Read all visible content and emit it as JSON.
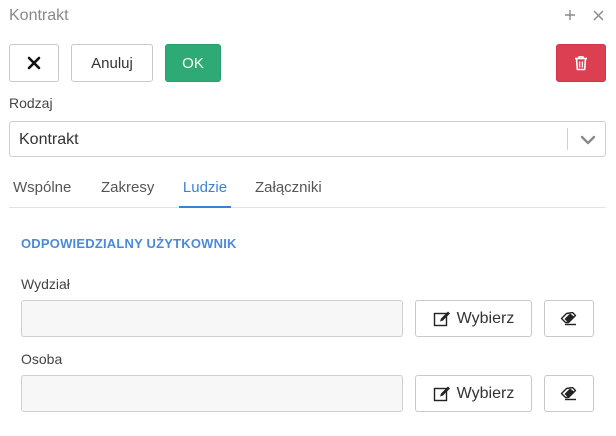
{
  "window": {
    "title": "Kontrakt",
    "add_icon": "plus-icon",
    "close_icon": "close-icon"
  },
  "toolbar": {
    "close_icon": "x-icon",
    "cancel_label": "Anuluj",
    "ok_label": "OK",
    "delete_icon": "trash-icon"
  },
  "form": {
    "type_label": "Rodzaj",
    "type_value": "Kontrakt"
  },
  "tabs": [
    {
      "label": "Wspólne",
      "active": false
    },
    {
      "label": "Zakresy",
      "active": false
    },
    {
      "label": "Ludzie",
      "active": true
    },
    {
      "label": "Załączniki",
      "active": false
    }
  ],
  "section": {
    "title": "ODPOWIEDZIALNY UŻYTKOWNIK",
    "department_label": "Wydział",
    "department_value": "",
    "person_label": "Osoba",
    "person_value": "",
    "choose_label": "Wybierz"
  },
  "colors": {
    "ok": "#2eaa76",
    "delete": "#dc3e52",
    "accent": "#3b82d4",
    "section_title": "#4a8ad8"
  }
}
